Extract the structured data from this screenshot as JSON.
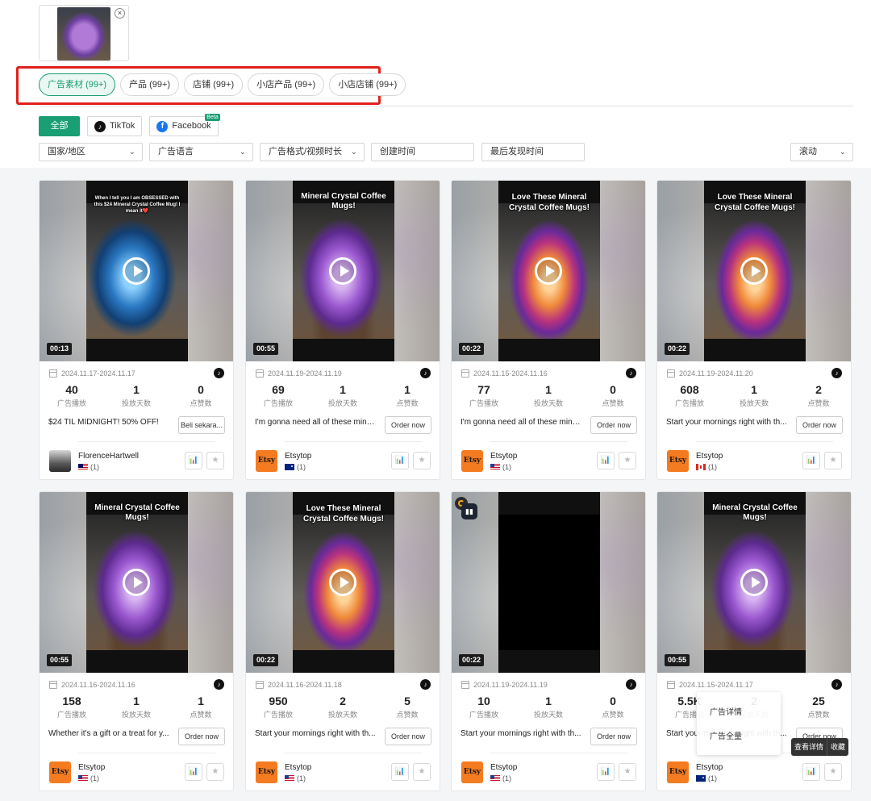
{
  "search_image": {
    "close_label": "×"
  },
  "tabs": [
    {
      "label": "广告素材 (99+)",
      "active": true
    },
    {
      "label": "产品 (99+)"
    },
    {
      "label": "店铺 (99+)"
    },
    {
      "label": "小店产品 (99+)"
    },
    {
      "label": "小店店铺 (99+)"
    }
  ],
  "platforms": {
    "all": "全部",
    "tiktok": "TikTok",
    "facebook": "Facebook",
    "facebook_badge": "Beta"
  },
  "filters": {
    "country": "国家/地区",
    "language": "广告语言",
    "format": "广告格式/视频时长",
    "created": "创建时间",
    "last_seen": "最后发现时间",
    "sort": "滚动"
  },
  "stat_labels": {
    "impressions": "广告播放",
    "days": "投放天数",
    "likes": "点赞数"
  },
  "cards": [
    {
      "duration": "00:13",
      "overlay": "When I tell you I am OBSESSED with this $24 Mineral Crystal Coffee Mug! I mean it❤️",
      "overlay_size": "small",
      "mug": "blue",
      "dates": "2024.11.17-2024.11.17",
      "impressions": "40",
      "days": "1",
      "likes": "0",
      "desc": "$24 TIL MIDNIGHT! 50% OFF!",
      "cta": "Beli sekara...",
      "advertiser": "FlorenceHartwell",
      "avatar": "person",
      "avatar_text": "",
      "flag": "my",
      "count": "(1)"
    },
    {
      "duration": "00:55",
      "overlay": "Mineral Crystal Coffee Mugs!",
      "overlay_size": "",
      "mug": "amethyst",
      "dates": "2024.11.19-2024.11.19",
      "impressions": "69",
      "days": "1",
      "likes": "1",
      "desc": "I'm gonna need all of these miner...",
      "cta": "Order now",
      "advertiser": "Etsytop",
      "avatar": "etsy",
      "avatar_text": "Etsy",
      "flag": "au",
      "count": "(1)"
    },
    {
      "duration": "00:22",
      "overlay": "Love These Mineral Crystal Coffee Mugs!",
      "overlay_size": "big",
      "mug": "coffee",
      "dates": "2024.11.15-2024.11.16",
      "impressions": "77",
      "days": "1",
      "likes": "0",
      "desc": "I'm gonna need all of these miner...",
      "cta": "Order now",
      "advertiser": "Etsytop",
      "avatar": "etsy",
      "avatar_text": "Etsy",
      "flag": "us",
      "count": "(1)"
    },
    {
      "duration": "00:22",
      "overlay": "Love These Mineral Crystal Coffee Mugs!",
      "overlay_size": "big",
      "mug": "coffee",
      "dates": "2024.11.19-2024.11.20",
      "impressions": "608",
      "days": "1",
      "likes": "2",
      "desc": "Start your mornings right with th...",
      "cta": "Order now",
      "advertiser": "Etsytop",
      "avatar": "etsy",
      "avatar_text": "Etsy",
      "flag": "ca",
      "count": "(1)"
    },
    {
      "duration": "00:55",
      "overlay": "Mineral Crystal Coffee Mugs!",
      "overlay_size": "",
      "mug": "amethyst",
      "dates": "2024.11.16-2024.11.16",
      "impressions": "158",
      "days": "1",
      "likes": "1",
      "desc": "Whether it's a gift or a treat for y...",
      "cta": "Order now",
      "advertiser": "Etsytop",
      "avatar": "etsy",
      "avatar_text": "Etsy",
      "flag": "us",
      "count": "(1)"
    },
    {
      "duration": "00:22",
      "overlay": "Love These Mineral Crystal Coffee Mugs!",
      "overlay_size": "big",
      "mug": "coffee",
      "dates": "2024.11.16-2024.11.18",
      "impressions": "950",
      "days": "2",
      "likes": "5",
      "desc": "Start your mornings right with th...",
      "cta": "Order now",
      "advertiser": "Etsytop",
      "avatar": "etsy",
      "avatar_text": "Etsy",
      "flag": "us",
      "count": "(1)"
    },
    {
      "duration": "00:22",
      "overlay": "",
      "overlay_size": "",
      "mug": "black",
      "dates": "2024.11.19-2024.11.19",
      "impressions": "10",
      "days": "1",
      "likes": "0",
      "desc": "Start your mornings right with th...",
      "cta": "Order now",
      "advertiser": "Etsytop",
      "avatar": "etsy",
      "avatar_text": "Etsy",
      "flag": "us",
      "count": "(1)",
      "loading": true
    },
    {
      "duration": "00:55",
      "overlay": "Mineral Crystal Coffee Mugs!",
      "overlay_size": "",
      "mug": "amethyst",
      "dates": "2024.11.15-2024.11.17",
      "impressions": "5.5K",
      "days": "2",
      "likes": "25",
      "desc": "Start your mornings right with th...",
      "cta": "Order now",
      "advertiser": "Etsytop",
      "avatar": "etsy",
      "avatar_text": "Etsy",
      "flag": "au",
      "count": "(1)"
    }
  ],
  "hover_menu": {
    "ad_detail": "广告详情",
    "collect": "广告全量",
    "view_detail": "查看详情",
    "favorite": "收藏"
  }
}
